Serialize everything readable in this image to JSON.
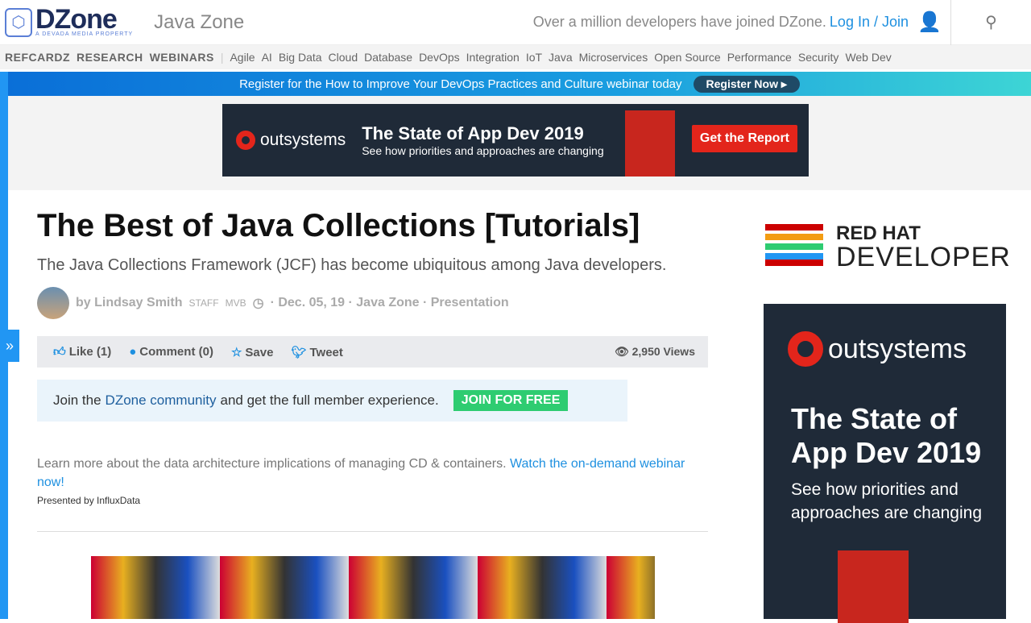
{
  "header": {
    "brand": "DZone",
    "brand_sub": "A DEVADA MEDIA PROPERTY",
    "zone": "Java Zone",
    "tagline": "Over a million developers have joined DZone.",
    "login": "Log In / Join"
  },
  "nav": {
    "primary": [
      "REFCARDZ",
      "RESEARCH",
      "WEBINARS"
    ],
    "topics": [
      "Agile",
      "AI",
      "Big Data",
      "Cloud",
      "Database",
      "DevOps",
      "Integration",
      "IoT",
      "Java",
      "Microservices",
      "Open Source",
      "Performance",
      "Security",
      "Web Dev"
    ]
  },
  "banner": {
    "text": "Register for the How to Improve Your DevOps Practices and Culture webinar today",
    "button": "Register Now ▸"
  },
  "ad_top": {
    "brand": "outsystems",
    "title": "The State of App Dev 2019",
    "subtitle": "See how priorities and approaches are changing",
    "cta": "Get the Report"
  },
  "article": {
    "title": "The Best of Java Collections [Tutorials]",
    "subtitle": "The Java Collections Framework (JCF) has become ubiquitous among Java developers.",
    "author": "by Lindsay Smith",
    "badges": [
      "STAFF",
      "MVB"
    ],
    "meta": "· Dec. 05, 19 · Java Zone · Presentation"
  },
  "actions": {
    "like": "Like (1)",
    "comment": "Comment (0)",
    "save": "Save",
    "tweet": "Tweet",
    "views": "2,950 Views"
  },
  "join": {
    "pre": "Join the",
    "link": "DZone community",
    "post": "and get the full member experience.",
    "button": "JOIN FOR FREE"
  },
  "promo": {
    "text": "Learn more about the data architecture implications of managing CD & containers.",
    "link": "Watch the on-demand webinar now!",
    "presented": "Presented by InfluxData"
  },
  "sidebar": {
    "rh1": "RED HAT",
    "rh2": "DEVELOPER",
    "ad_brand": "outsystems",
    "ad_title": "The State of App Dev 2019",
    "ad_sub": "See how priorities and approaches are changing"
  }
}
